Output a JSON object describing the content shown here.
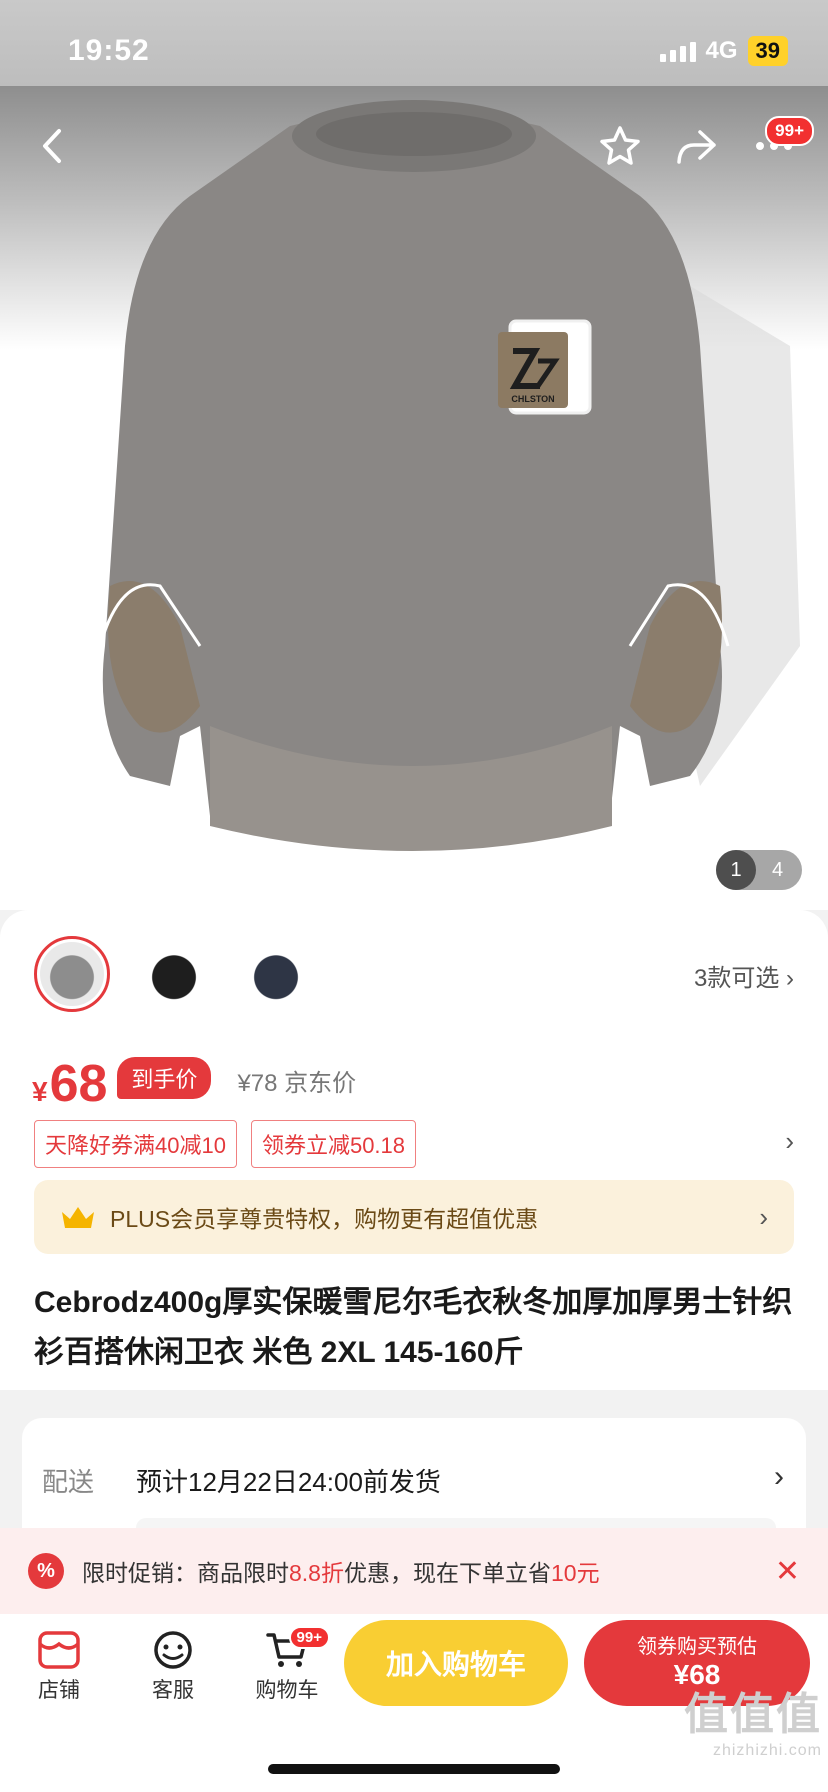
{
  "status_bar": {
    "time": "19:52",
    "network": "4G",
    "battery": "39"
  },
  "hero": {
    "menu_badge": "99+",
    "pager": {
      "current": "1",
      "total": "4"
    },
    "logo_text": "CHLSTON"
  },
  "variants": {
    "count_label": "3款可选",
    "items": [
      {
        "color": "#8d8d8d",
        "selected": true
      },
      {
        "color": "#1e1e1e",
        "selected": false
      },
      {
        "color": "#2e3545",
        "selected": false
      }
    ]
  },
  "price": {
    "symbol": "¥",
    "value": "68",
    "tag": "到手价",
    "jd_price": "¥78 京东价"
  },
  "coupons": [
    "天降好券满40减10",
    "领券立减50.18"
  ],
  "plus": {
    "text": "PLUS会员享尊贵特权，购物更有超值优惠"
  },
  "product": {
    "title": "Cebrodz400g厚实保暖雪尼尔毛衣秋冬加厚加厚男士针织衫百搭休闲卫衣 米色 2XL 145-160斤"
  },
  "delivery": {
    "label": "配送",
    "text": "预计12月22日24:00前发货"
  },
  "promo": {
    "icon": "%",
    "prefix": "限时促销：商品限时",
    "discount": "8.8折",
    "middle": "优惠，现在下单立省",
    "save": "10元"
  },
  "bottom_bar": {
    "store": "店铺",
    "service": "客服",
    "cart": "购物车",
    "cart_badge": "99+",
    "add_to_cart": "加入购物车",
    "buy_line1": "领券购买预估",
    "buy_line2": "¥68"
  },
  "watermark": {
    "logo": "值值值",
    "url": "zhizhizhi.com"
  },
  "colors": {
    "accent": "#e4393c",
    "cart_button": "#f9ce33",
    "plus_bg": "#fbf1dc"
  }
}
